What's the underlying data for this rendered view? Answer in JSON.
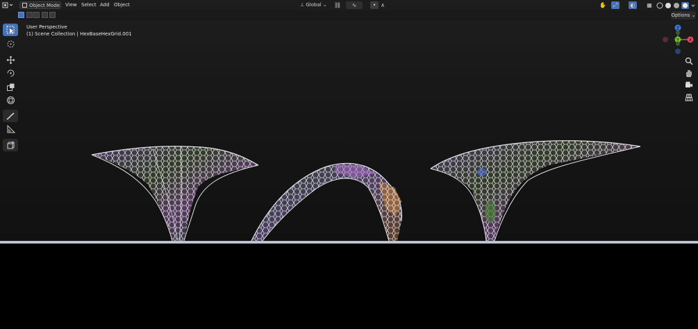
{
  "header": {
    "mode": "Object Mode",
    "menus": [
      "View",
      "Select",
      "Add",
      "Object"
    ],
    "orientation": "Global",
    "options_label": "Options"
  },
  "overlay": {
    "perspective": "User Perspective",
    "collection": "(1) Scene Collection | HexBaseHexGrid.001"
  },
  "gizmo": {
    "z": "Z",
    "y": "Y",
    "x": "X"
  },
  "toolbar": {
    "tools": [
      "select-box",
      "cursor",
      "move",
      "rotate",
      "scale",
      "transform",
      "annotate",
      "measure",
      "add-cube"
    ],
    "active": "select-box"
  },
  "colors": {
    "accent": "#4772b3",
    "axis_x": "#e0495e",
    "axis_y": "#76bd2c",
    "axis_z": "#3b7bd8",
    "mesh_wire": "#cfd3d8"
  }
}
